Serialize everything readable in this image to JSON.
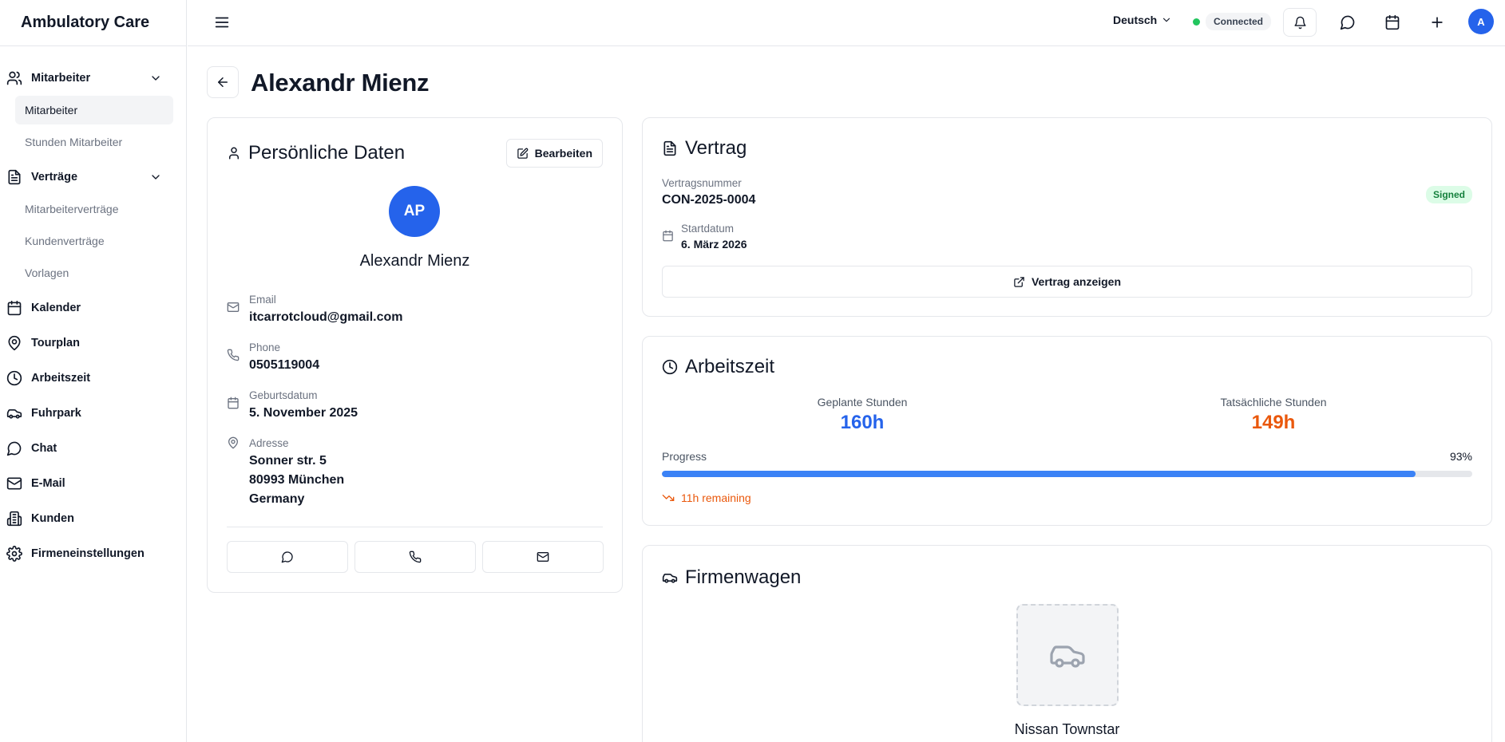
{
  "app": {
    "title": "Ambulatory Care"
  },
  "sidebar": {
    "groups": [
      {
        "label": "Mitarbeiter",
        "icon": "users-icon"
      },
      {
        "label": "Verträge",
        "icon": "document-icon"
      }
    ],
    "employee_items": [
      "Mitarbeiter",
      "Stunden Mitarbeiter"
    ],
    "contract_items": [
      "Mitarbeiterverträge",
      "Kundenverträge",
      "Vorlagen"
    ],
    "items": [
      {
        "label": "Kalender",
        "icon": "calendar-icon"
      },
      {
        "label": "Tourplan",
        "icon": "map-pin-icon"
      },
      {
        "label": "Arbeitszeit",
        "icon": "clock-icon"
      },
      {
        "label": "Fuhrpark",
        "icon": "car-icon"
      },
      {
        "label": "Chat",
        "icon": "chat-icon"
      },
      {
        "label": "E-Mail",
        "icon": "mail-icon"
      },
      {
        "label": "Kunden",
        "icon": "building-icon"
      },
      {
        "label": "Firmeneinstellungen",
        "icon": "gear-icon"
      }
    ]
  },
  "topbar": {
    "language": "Deutsch",
    "status": "Connected",
    "status_color": "#22c55e",
    "avatar_initial": "A"
  },
  "page": {
    "title": "Alexandr Mienz"
  },
  "personal": {
    "title": "Persönliche Daten",
    "edit_label": "Bearbeiten",
    "initials": "AP",
    "name": "Alexandr Mienz",
    "email_label": "Email",
    "email": "itcarrotcloud@gmail.com",
    "phone_label": "Phone",
    "phone": "0505119004",
    "birth_label": "Geburtsdatum",
    "birth": "5. November 2025",
    "address_label": "Adresse",
    "address_lines": [
      "Sonner str. 5",
      "80993 München",
      "Germany"
    ]
  },
  "contract": {
    "title": "Vertrag",
    "number_label": "Vertragsnummer",
    "number": "CON-2025-0004",
    "status": "Signed",
    "start_label": "Startdatum",
    "start": "6. März 2026",
    "view_label": "Vertrag anzeigen"
  },
  "worktime": {
    "title": "Arbeitszeit",
    "planned_label": "Geplante Stunden",
    "planned": "160h",
    "planned_color": "#2563eb",
    "actual_label": "Tatsächliche Stunden",
    "actual": "149h",
    "actual_color": "#ea580c",
    "progress_label": "Progress",
    "progress_text": "93%",
    "progress_value": 93,
    "remaining": "11h remaining"
  },
  "car": {
    "title": "Firmenwagen",
    "name": "Nissan Townstar"
  }
}
